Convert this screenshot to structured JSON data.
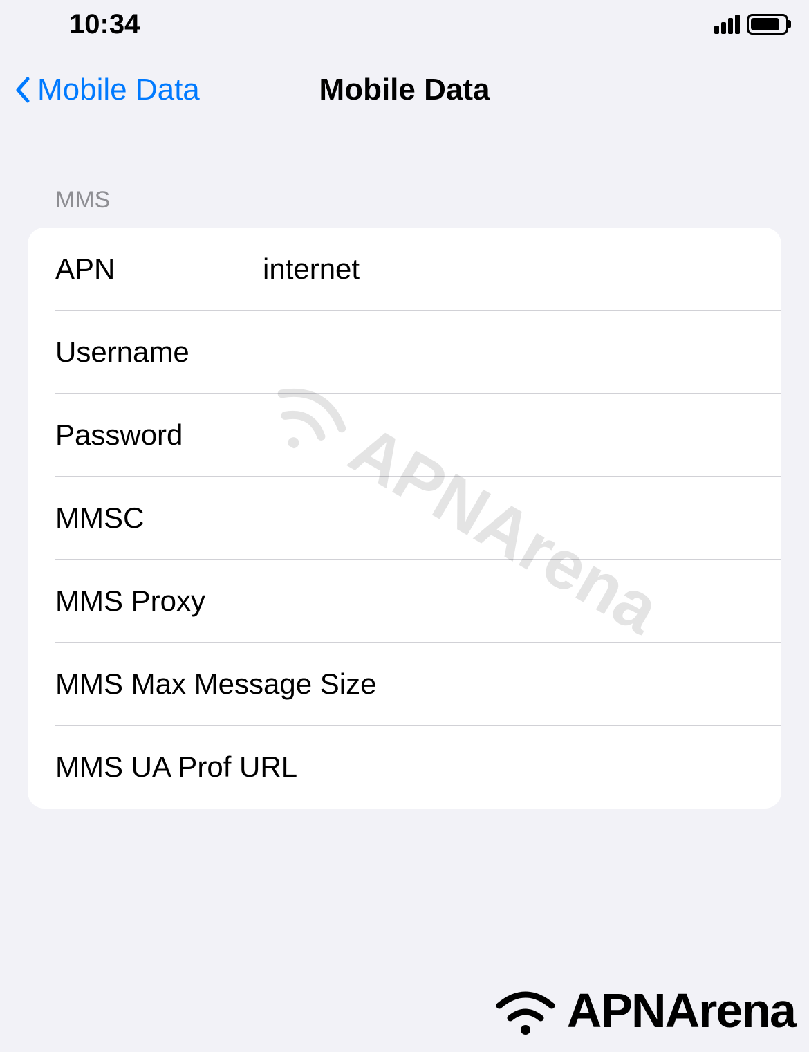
{
  "statusBar": {
    "time": "10:34"
  },
  "nav": {
    "backLabel": "Mobile Data",
    "title": "Mobile Data"
  },
  "section": {
    "header": "MMS",
    "rows": [
      {
        "label": "APN",
        "value": "internet"
      },
      {
        "label": "Username",
        "value": ""
      },
      {
        "label": "Password",
        "value": ""
      },
      {
        "label": "MMSC",
        "value": ""
      },
      {
        "label": "MMS Proxy",
        "value": ""
      },
      {
        "label": "MMS Max Message Size",
        "value": ""
      },
      {
        "label": "MMS UA Prof URL",
        "value": ""
      }
    ]
  },
  "watermark": "APNArena",
  "footerLogo": "APNArena"
}
